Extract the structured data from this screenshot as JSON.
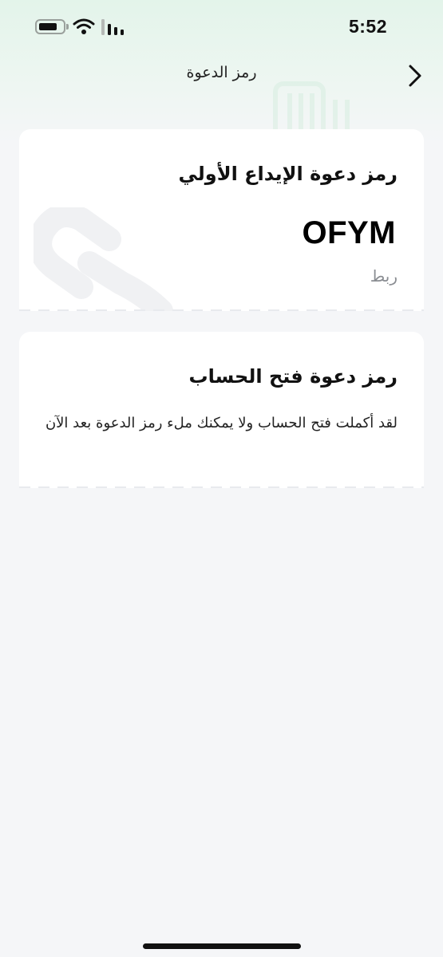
{
  "status_bar": {
    "time": "5:52",
    "battery_icon": "battery-icon",
    "wifi_icon": "wifi-icon",
    "signal_icon": "cellular-signal-icon"
  },
  "header": {
    "title": "رمز الدعوة",
    "back_icon": "chevron-right-icon"
  },
  "first_deposit_card": {
    "title": "رمز دعوة الإيداع الأولي",
    "code": "OFYM",
    "status": "ربط",
    "watermark_icon": "link-icon"
  },
  "account_opening_card": {
    "title": "رمز دعوة فتح الحساب",
    "description": "لقد أكملت فتح الحساب ولا يمكنك ملء رمز الدعوة بعد الآن"
  },
  "colors": {
    "header_tint": "#e3f4ea",
    "page_background": "#f5f6f8",
    "card_background": "#ffffff",
    "muted_text": "#8a8d92"
  }
}
